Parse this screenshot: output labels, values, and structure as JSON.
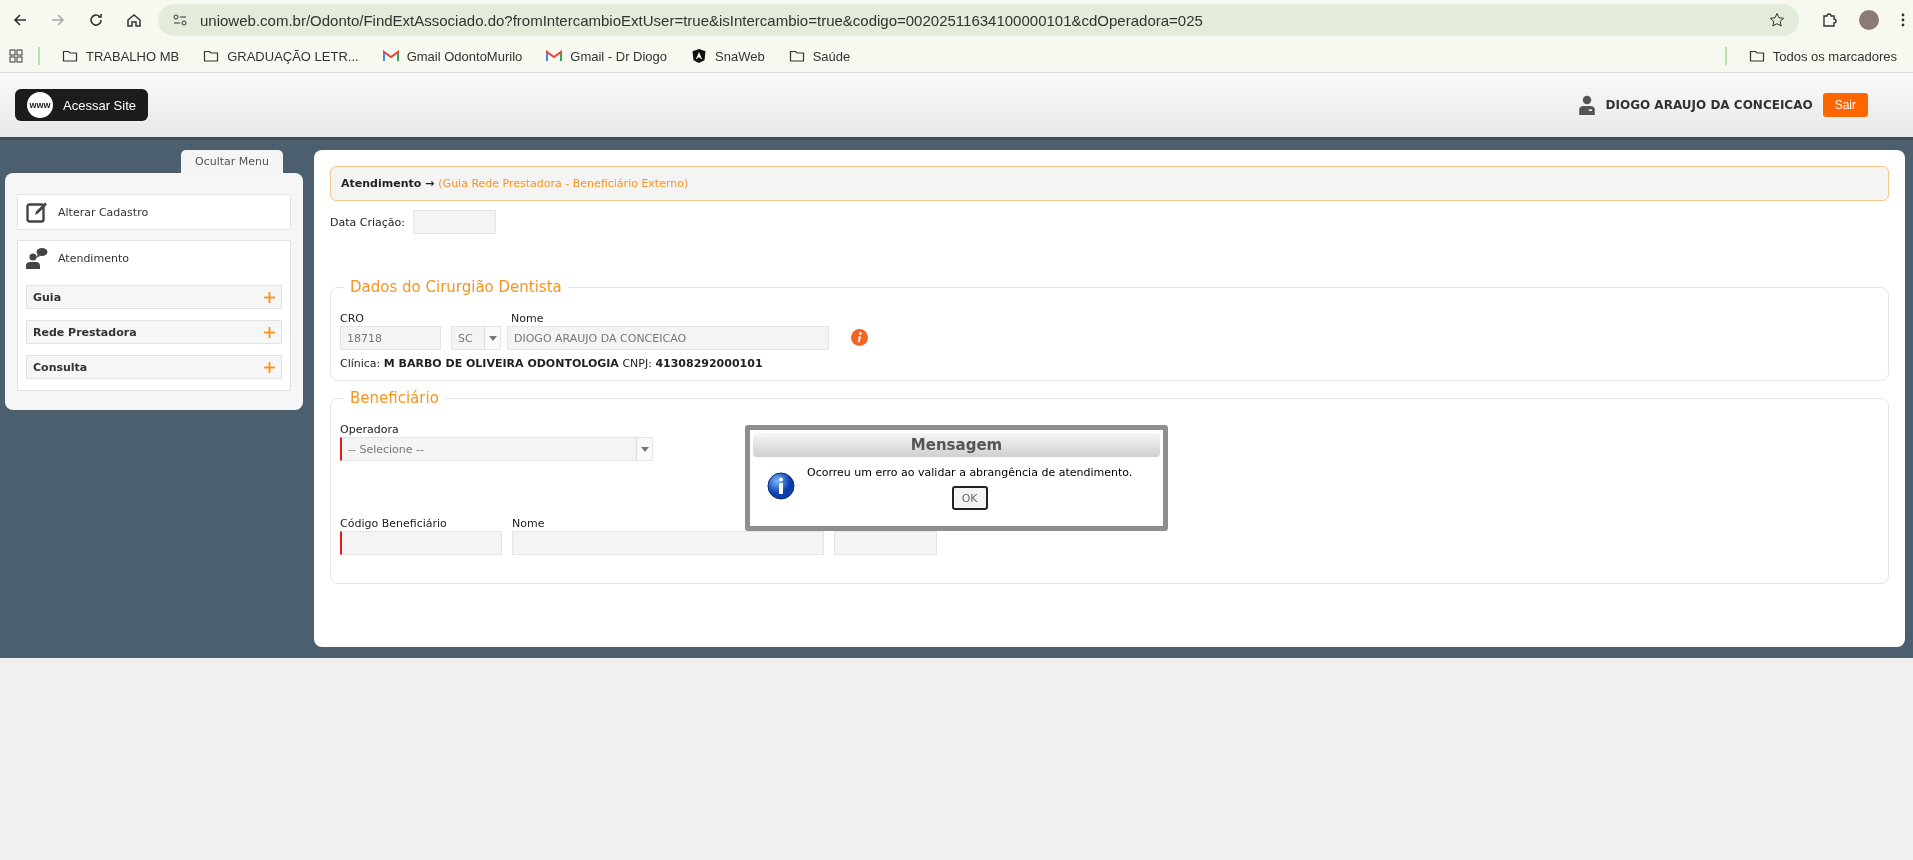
{
  "browser": {
    "url": "unioweb.com.br/Odonto/FindExtAssociado.do?fromIntercambioExtUser=true&isIntercambio=true&codigo=00202511634100000101&cdOperadora=025",
    "bookmarks": [
      {
        "kind": "folder",
        "label": "TRABALHO MB"
      },
      {
        "kind": "folder",
        "label": "GRADUAÇÃO LETR..."
      },
      {
        "kind": "gmail",
        "label": "Gmail OdontoMurilo"
      },
      {
        "kind": "gmail",
        "label": "Gmail - Dr Diogo"
      },
      {
        "kind": "angular",
        "label": "SnaWeb"
      },
      {
        "kind": "folder",
        "label": "Saúde"
      }
    ],
    "all_bookmarks": "Todos os marcadores"
  },
  "header": {
    "site_button": "Acessar Site",
    "site_badge": "www",
    "user_name": "DIOGO ARAUJO DA CONCEICAO",
    "logout": "Sair"
  },
  "sidebar": {
    "toggle": "Ocultar Menu",
    "items": [
      {
        "kind": "edit",
        "label": "Alterar Cadastro"
      },
      {
        "kind": "chat",
        "label": "Atendimento",
        "children": [
          {
            "label": "Guia",
            "expanded": false
          },
          {
            "label": "Rede Prestadora",
            "expanded": false
          },
          {
            "label": "Consulta",
            "expanded": false
          }
        ]
      }
    ]
  },
  "breadcrumb": {
    "root": "Atendimento",
    "arrow": "→",
    "current": "(Guia Rede Prestadora - Beneficiário Externo)"
  },
  "data_criacao": {
    "label": "Data Criação:"
  },
  "dentista": {
    "legend": "Dados do Cirurgião Dentista",
    "cro_label": "CRO",
    "cro_value": "18718",
    "uf_value": "SC",
    "nome_label": "Nome",
    "nome_value": "DIOGO ARAUJO DA CONCEICAO",
    "clinica_label": "Clínica:",
    "clinica_value": "M BARBO DE OLIVEIRA ODONTOLOGIA",
    "cnpj_label": "CNPJ:",
    "cnpj_value": "41308292000101"
  },
  "beneficiario": {
    "legend": "Beneficiário",
    "operadora_label": "Operadora",
    "operadora_placeholder": "-- Selecione --",
    "codigo_label": "Código Beneficiário",
    "nome_label": "Nome"
  },
  "dialog": {
    "title": "Mensagem",
    "message": "Ocorreu um erro ao validar a abrangência de atendimento.",
    "button": "OK"
  }
}
